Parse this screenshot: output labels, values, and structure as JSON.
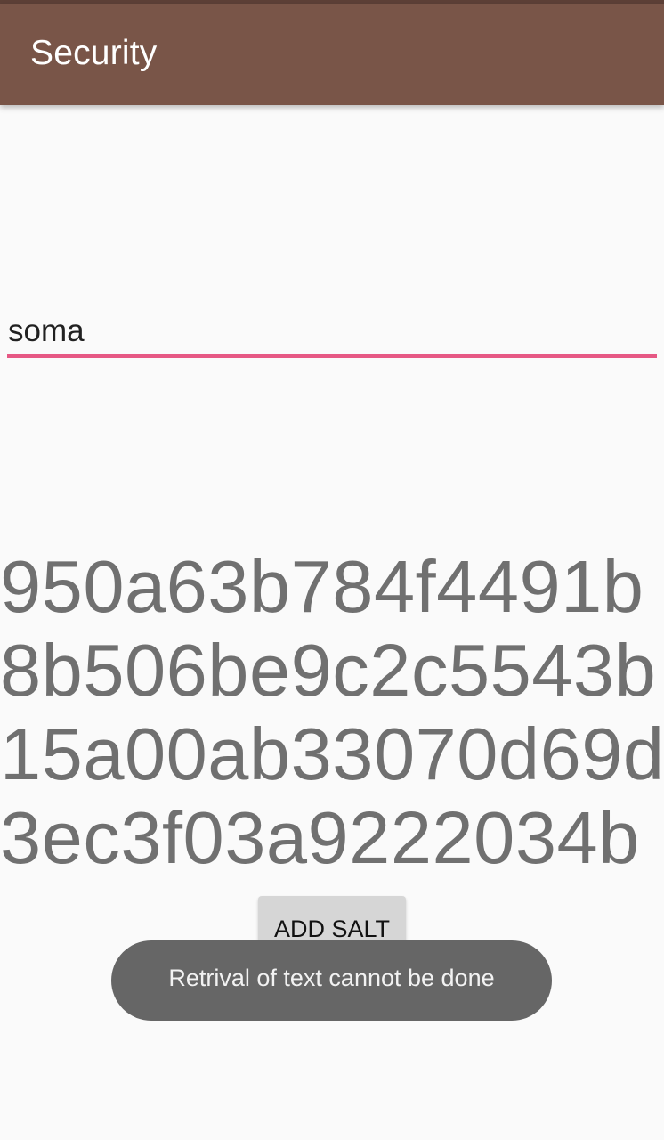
{
  "app_bar": {
    "title": "Security",
    "color": "#795548"
  },
  "input": {
    "value": "soma",
    "accent_color": "#e65884"
  },
  "hash_output": {
    "lines": [
      "950a63b784f4491b",
      "8b506be9c2c5543b",
      "15a00ab33070d69d",
      "3ec3f03a9222034b"
    ]
  },
  "add_salt_button": {
    "label": "ADD SALT"
  },
  "toast": {
    "message": "Retrival of text cannot be done"
  }
}
